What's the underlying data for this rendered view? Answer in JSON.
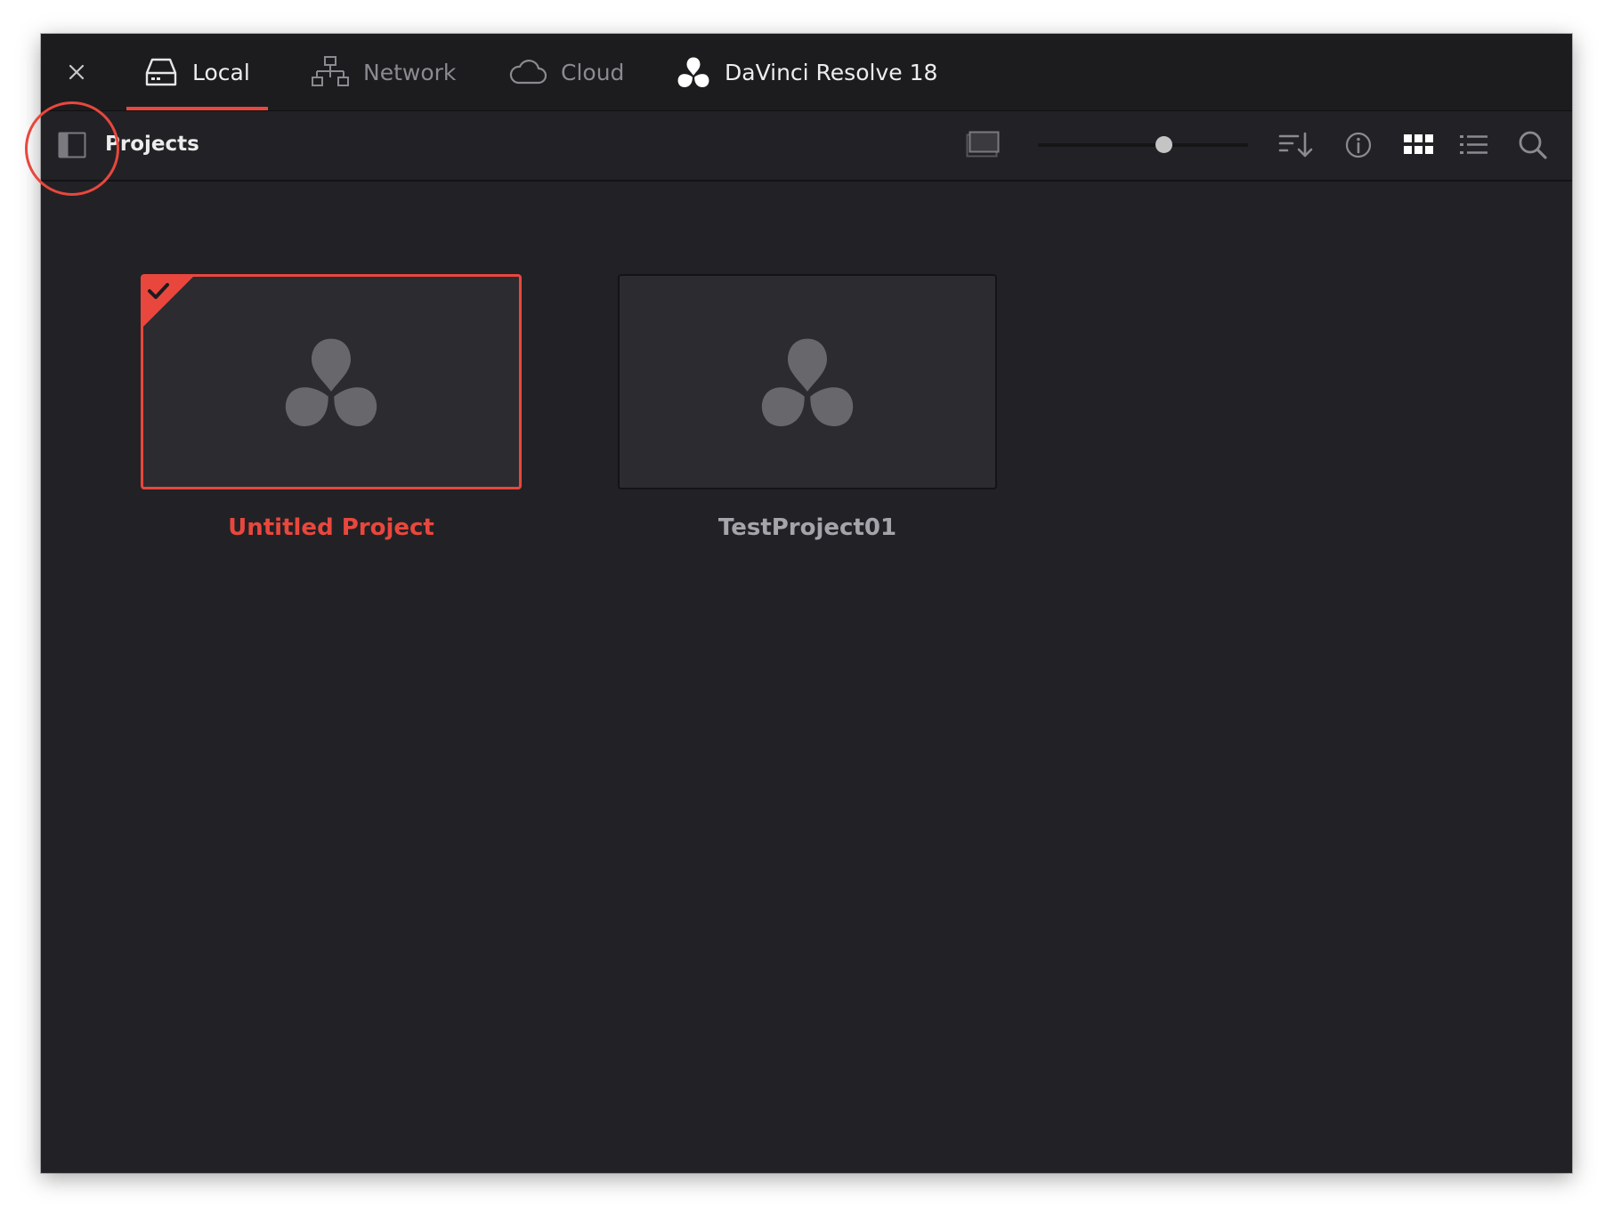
{
  "window": {
    "close_label": "×"
  },
  "tabs": [
    {
      "label": "Local",
      "icon": "hard-drive-icon",
      "active": true
    },
    {
      "label": "Network",
      "icon": "network-icon",
      "active": false
    },
    {
      "label": "Cloud",
      "icon": "cloud-icon",
      "active": false
    },
    {
      "label": "DaVinci Resolve 18",
      "icon": "davinci-resolve-logo-icon",
      "active": false
    }
  ],
  "toolbar": {
    "projects_label": "Projects",
    "sidebar_toggle_icon": "sidebar-toggle-icon",
    "thumbnail_view_icon": "thumbnail-preview-icon",
    "thumbnail_size_value": 0.6,
    "sort_icon": "sort-icon",
    "info_icon": "info-icon",
    "grid_view_icon": "grid-view-icon",
    "list_view_icon": "list-view-icon",
    "search_icon": "search-icon"
  },
  "projects": [
    {
      "name": "Untitled Project",
      "selected": true
    },
    {
      "name": "TestProject01",
      "selected": false
    }
  ],
  "colors": {
    "accent": "#e9473d",
    "window_bg": "#222226",
    "tabbar_bg": "#1c1c1f",
    "thumbnail_bg": "#2c2c30"
  }
}
